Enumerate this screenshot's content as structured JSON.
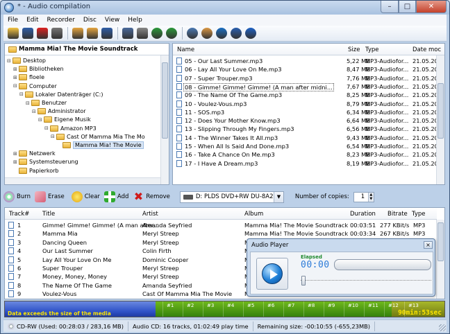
{
  "window": {
    "title": "* - Audio compilation"
  },
  "menu": [
    "File",
    "Edit",
    "Recorder",
    "Disc",
    "View",
    "Help"
  ],
  "toolbar_icons": [
    "new-icon",
    "save-icon",
    "delete-icon",
    "print-icon",
    "add-disc-icon",
    "add-disc2-icon",
    "bookmark-icon",
    "info-drive-icon",
    "drive-icon",
    "web-icon",
    "globe-icon",
    "settings-icon",
    "paint-icon",
    "world-icon",
    "help-icon",
    "about-icon"
  ],
  "tree": {
    "current": "Mamma Mia! The Movie Soundtrack",
    "items": [
      {
        "label": "Desktop",
        "depth": 0,
        "exp": "-"
      },
      {
        "label": "Bibliotheken",
        "depth": 1,
        "exp": "+"
      },
      {
        "label": "floele",
        "depth": 1,
        "exp": "+"
      },
      {
        "label": "Computer",
        "depth": 1,
        "exp": "-"
      },
      {
        "label": "Lokaler Datenträger (C:)",
        "depth": 2,
        "exp": "-"
      },
      {
        "label": "Benutzer",
        "depth": 3,
        "exp": "-"
      },
      {
        "label": "Administrator",
        "depth": 4,
        "exp": "-"
      },
      {
        "label": "Eigene Musik",
        "depth": 5,
        "exp": "-"
      },
      {
        "label": "Amazon MP3",
        "depth": 6,
        "exp": "-"
      },
      {
        "label": "Cast Of Mamma Mia The Mo",
        "depth": 7,
        "exp": "-"
      },
      {
        "label": "Mamma Mia! The Movie",
        "depth": 8,
        "exp": "",
        "selected": true
      },
      {
        "label": "Netzwerk",
        "depth": 1,
        "exp": "+"
      },
      {
        "label": "Systemsteuerung",
        "depth": 1,
        "exp": "+"
      },
      {
        "label": "Papierkorb",
        "depth": 1,
        "exp": ""
      }
    ]
  },
  "filelist": {
    "columns": [
      "Name",
      "Size",
      "Type",
      "Date moc"
    ],
    "rows": [
      {
        "name": "05 - Our Last Summer.mp3",
        "size": "5,22 MB",
        "type": "MP3-Audiofor...",
        "date": "21.05.20("
      },
      {
        "name": "06 - Lay All Your Love On Me.mp3",
        "size": "8,47 MB",
        "type": "MP3-Audiofor...",
        "date": "21.05.20("
      },
      {
        "name": "07 - Super Trouper.mp3",
        "size": "7,76 MB",
        "type": "MP3-Audiofor...",
        "date": "21.05.20("
      },
      {
        "name": "08 - Gimme! Gimme! Gimme! (A man after midni...",
        "size": "7,67 MB",
        "type": "MP3-Audiofor...",
        "date": "21.05.20(",
        "selected": true
      },
      {
        "name": "09 - The Name Of The Game.mp3",
        "size": "8,25 MB",
        "type": "MP3-Audiofor...",
        "date": "21.05.20("
      },
      {
        "name": "10 - Voulez-Vous.mp3",
        "size": "8,79 MB",
        "type": "MP3-Audiofor...",
        "date": "21.05.20("
      },
      {
        "name": "11 - SOS.mp3",
        "size": "6,34 MB",
        "type": "MP3-Audiofor...",
        "date": "21.05.20("
      },
      {
        "name": "12 - Does Your Mother Know.mp3",
        "size": "6,64 MB",
        "type": "MP3-Audiofor...",
        "date": "21.05.20("
      },
      {
        "name": "13 - Slipping Through My Fingers.mp3",
        "size": "6,56 MB",
        "type": "MP3-Audiofor...",
        "date": "21.05.20("
      },
      {
        "name": "14 - The Winner Takes It All.mp3",
        "size": "9,43 MB",
        "type": "MP3-Audiofor...",
        "date": "21.05.20("
      },
      {
        "name": "15 - When All Is Said And Done.mp3",
        "size": "6,54 MB",
        "type": "MP3-Audiofor...",
        "date": "21.05.20("
      },
      {
        "name": "16 - Take A Chance On Me.mp3",
        "size": "8,23 MB",
        "type": "MP3-Audiofor...",
        "date": "21.05.20("
      },
      {
        "name": "17 - I Have A Dream.mp3",
        "size": "8,19 MB",
        "type": "MP3-Audiofor...",
        "date": "21.05.20("
      }
    ]
  },
  "midbar": {
    "burn": "Burn",
    "erase": "Erase",
    "clear": "Clear",
    "add": "Add",
    "remove": "Remove",
    "drive": "D: PLDS DVD+RW DU-8A2S",
    "copies_label": "Number of copies:",
    "copies_value": "1"
  },
  "tracks": {
    "columns": [
      "Track#",
      "Title",
      "Artist",
      "Album",
      "Duration",
      "Bitrate",
      "Type"
    ],
    "rows": [
      {
        "num": "1",
        "title": "Gimme! Gimme! Gimme! (A man after...",
        "artist": "Amanda Seyfried",
        "album": "Mamma Mia! The Movie Soundtrack",
        "duration": "00:03:51",
        "bitrate": "277 KBit/s",
        "type": "MP3"
      },
      {
        "num": "2",
        "title": "Mamma Mia",
        "artist": "Meryl Streep",
        "album": "Mamma Mia! The Movie Soundtrack",
        "duration": "00:03:34",
        "bitrate": "267 KBit/s",
        "type": "MP3"
      },
      {
        "num": "3",
        "title": "Dancing Queen",
        "artist": "Meryl Streep",
        "album": "Mamma Mia! The Movie Soundtrack",
        "duration": "",
        "bitrate": "",
        "type": ""
      },
      {
        "num": "4",
        "title": "Our Last Summer",
        "artist": "Colin Firth",
        "album": "Mamma Mia! The Movie Soundtrack",
        "duration": "",
        "bitrate": "",
        "type": ""
      },
      {
        "num": "5",
        "title": "Lay All Your Love On Me",
        "artist": "Dominic Cooper",
        "album": "Mamma Mia! The Movie Soundtrack",
        "duration": "",
        "bitrate": "",
        "type": ""
      },
      {
        "num": "6",
        "title": "Super Trouper",
        "artist": "Meryl Streep",
        "album": "Mamma Mia! The Movie Soundtrack",
        "duration": "",
        "bitrate": "",
        "type": ""
      },
      {
        "num": "7",
        "title": "Money, Money, Money",
        "artist": "Meryl Streep",
        "album": "Mamma Mia! The Movie Soundtrack",
        "duration": "",
        "bitrate": "",
        "type": ""
      },
      {
        "num": "8",
        "title": "The Name Of The Game",
        "artist": "Amanda Seyfried",
        "album": "Mamma Mia! The Movie Soundtrack",
        "duration": "",
        "bitrate": "",
        "type": ""
      },
      {
        "num": "9",
        "title": "Voulez-Vous",
        "artist": "Cast Of Mamma Mia The Movie",
        "album": "Mamma Mia! The Movie Soundtrack",
        "duration": "",
        "bitrate": "",
        "type": ""
      }
    ]
  },
  "player": {
    "title": "Audio Player",
    "elapsed_label": "Elapsed",
    "elapsed": "00:00",
    "close": "×"
  },
  "capacity": {
    "warning": "Data exceeds the size of the media",
    "total": "90min:53sec",
    "ticks": [
      "#1",
      "#2",
      "#3",
      "#4",
      "#5",
      "#6",
      "#7",
      "#8",
      "#9",
      "#10",
      "#11",
      "#12",
      "#13"
    ]
  },
  "status": {
    "disc": "CD-RW (Used: 00:28:03 / 283,16 MB)",
    "audio": "Audio CD: 16 tracks, 01:02:49 play time",
    "remaining": "Remaining size: -00:10:55 (-655,23MB)"
  }
}
